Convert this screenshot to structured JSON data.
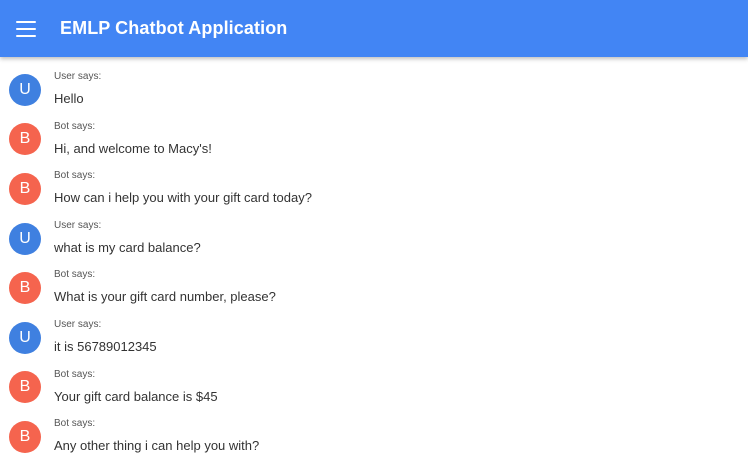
{
  "app": {
    "title": "EMLP Chatbot Application"
  },
  "colors": {
    "app_bar": "#4285f4",
    "user_avatar": "#3f80e0",
    "bot_avatar": "#f5644e"
  },
  "icons": {
    "menu": "hamburger-menu-icon"
  },
  "messages": [
    {
      "role": "user",
      "avatar": "U",
      "speaker": "User says:",
      "text": "Hello"
    },
    {
      "role": "bot",
      "avatar": "B",
      "speaker": "Bot says:",
      "text": "Hi, and welcome to Macy's!"
    },
    {
      "role": "bot",
      "avatar": "B",
      "speaker": "Bot says:",
      "text": "How can i help you with your gift card today?"
    },
    {
      "role": "user",
      "avatar": "U",
      "speaker": "User says:",
      "text": "what is my card balance?"
    },
    {
      "role": "bot",
      "avatar": "B",
      "speaker": "Bot says:",
      "text": "What is your gift card number, please?"
    },
    {
      "role": "user",
      "avatar": "U",
      "speaker": "User says:",
      "text": "it is 56789012345"
    },
    {
      "role": "bot",
      "avatar": "B",
      "speaker": "Bot says:",
      "text": "Your gift card balance is $45"
    },
    {
      "role": "bot",
      "avatar": "B",
      "speaker": "Bot says:",
      "text": "Any other thing i can help you with?"
    }
  ]
}
